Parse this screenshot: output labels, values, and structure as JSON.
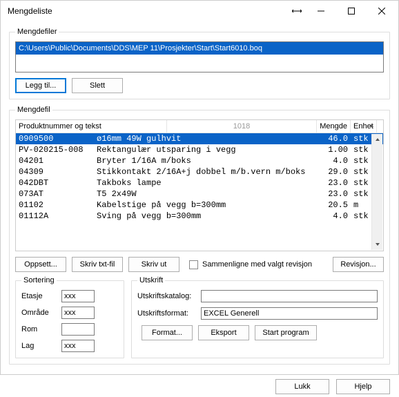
{
  "window_title": "Mengdeliste",
  "groups": {
    "files": "Mengdefiler",
    "list": "Mengdefil",
    "sort": "Sortering",
    "print": "Utskrift"
  },
  "filelist": {
    "items": [
      "C:\\Users\\Public\\Documents\\DDS\\MEP 11\\Prosjekter\\Start\\Start6010.boq"
    ]
  },
  "buttons": {
    "add": "Legg til...",
    "delete": "Slett",
    "setup": "Oppsett...",
    "writetxt": "Skriv txt-fil",
    "print": "Skriv ut",
    "compare": "Sammenligne med valgt revisjon",
    "revision": "Revisjon...",
    "format": "Format...",
    "export": "Eksport",
    "start_program": "Start program",
    "close": "Lukk",
    "help": "Hjelp"
  },
  "grid": {
    "headers": {
      "prod": "Produktnummer og tekst",
      "sortnum": "1018",
      "qty": "Mengde",
      "unit": "Enhet"
    },
    "rows": [
      {
        "prod": "0909500",
        "text": "ø16mm 49W gulhvit",
        "qty": "46.0",
        "unit": "stk",
        "selected": true
      },
      {
        "prod": "PV-020215-008",
        "text": "Rektangulær utsparing i vegg",
        "qty": "1.00",
        "unit": "stk"
      },
      {
        "prod": "04201",
        "text": "Bryter 1/16A m/boks",
        "qty": "4.0",
        "unit": "stk"
      },
      {
        "prod": "04309",
        "text": "Stikkontakt 2/16A+j dobbel m/b.vern m/boks",
        "qty": "29.0",
        "unit": "stk"
      },
      {
        "prod": "042DBT",
        "text": "Takboks  lampe",
        "qty": "23.0",
        "unit": "stk"
      },
      {
        "prod": "073AT",
        "text": "T5 2x49W",
        "qty": "23.0",
        "unit": "stk"
      },
      {
        "prod": "01102",
        "text": "Kabelstige på vegg b=300mm",
        "qty": "20.5",
        "unit": "m"
      },
      {
        "prod": "01112A",
        "text": "Sving på vegg b=300mm",
        "qty": "4.0",
        "unit": "stk"
      }
    ]
  },
  "sort": {
    "labels": {
      "floor": "Etasje",
      "area": "Område",
      "room": "Rom",
      "layer": "Lag"
    },
    "values": {
      "floor": "xxx",
      "area": "xxx",
      "room": "",
      "layer": "xxx"
    }
  },
  "print_panel": {
    "labels": {
      "catalog": "Utskriftskatalog:",
      "format": "Utskriftsformat:"
    },
    "values": {
      "catalog": "",
      "format": "EXCEL Generell"
    }
  }
}
